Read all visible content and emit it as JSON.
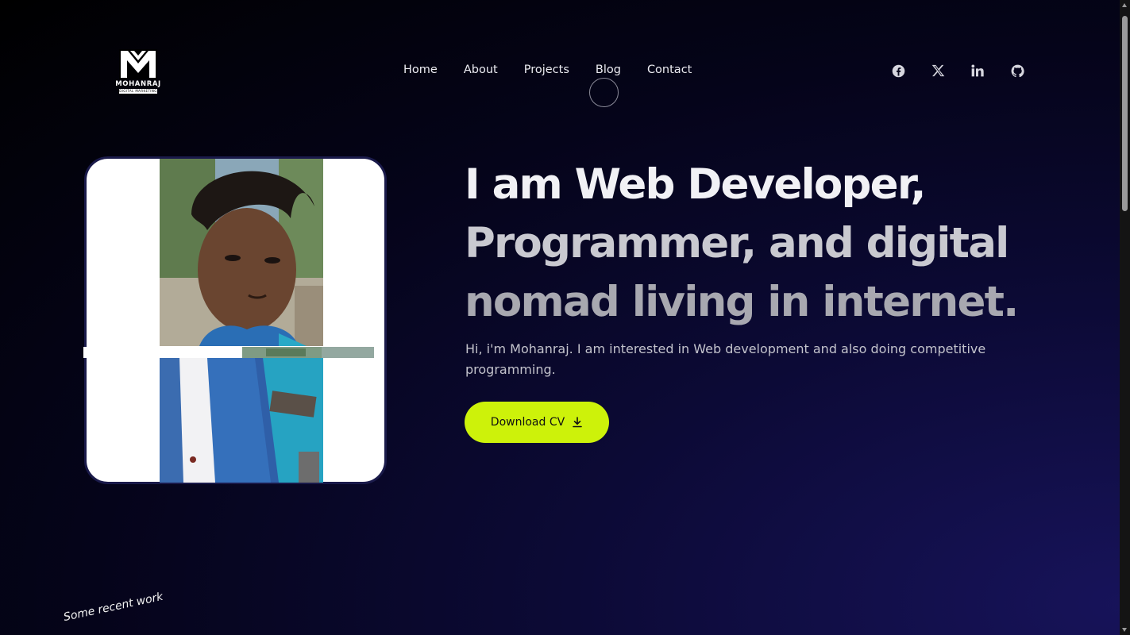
{
  "logo": {
    "name": "MOHANRAJ",
    "tagline": "DIGITAL MARKETING"
  },
  "nav": {
    "items": [
      {
        "label": "Home"
      },
      {
        "label": "About"
      },
      {
        "label": "Projects"
      },
      {
        "label": "Blog"
      },
      {
        "label": "Contact"
      }
    ]
  },
  "social": {
    "icons": [
      "facebook-icon",
      "x-twitter-icon",
      "linkedin-icon",
      "github-icon"
    ]
  },
  "hero": {
    "line1": "I am Web Developer,",
    "line2": "Programmer, and digital",
    "line3": "nomad living in internet.",
    "intro": "Hi, i'm Mohanraj. I am interested in Web development and also doing competitive programming.",
    "cta_label": "Download CV",
    "cta_icon": "download-icon"
  },
  "section_label": "Some recent work",
  "colors": {
    "accent": "#cdf20a",
    "background_dark": "#000000",
    "background_glow": "#17135a"
  }
}
